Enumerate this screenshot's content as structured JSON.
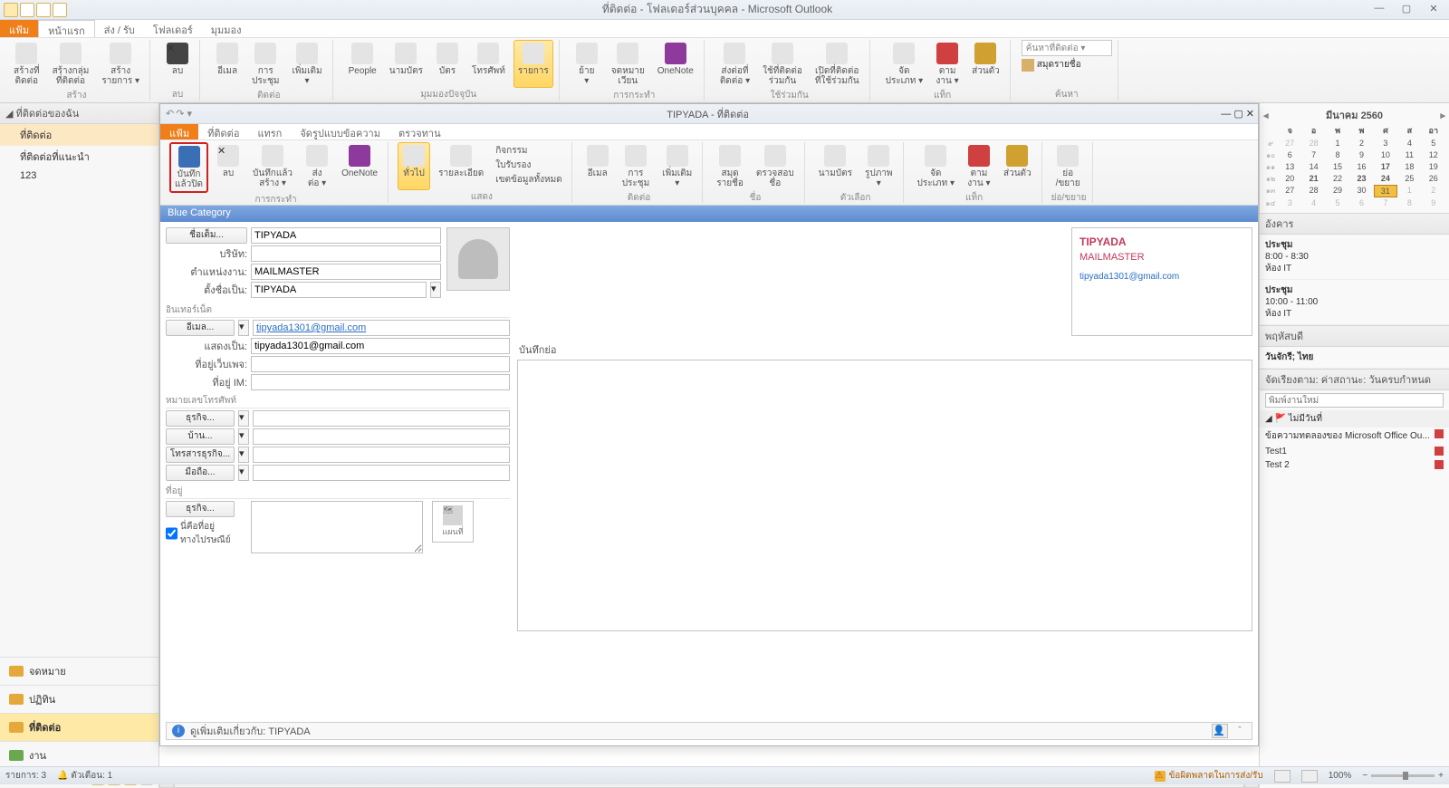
{
  "titlebar": {
    "title": "ที่ติดต่อ - โฟลเดอร์ส่วนบุคคล - Microsoft Outlook"
  },
  "tabs": {
    "file": "แฟ้ม",
    "home": "หน้าแรก",
    "send": "ส่ง / รับ",
    "folder": "โฟลเดอร์",
    "view": "มุมมอง"
  },
  "ribbon": {
    "g1": {
      "b1": "สร้างที่\nติดต่อ",
      "b2": "สร้างกลุ่ม\nที่ติดต่อ",
      "b3": "สร้าง\nรายการ ▾",
      "label": "สร้าง"
    },
    "g2": {
      "b1": "ลบ",
      "label": "ลบ"
    },
    "g3": {
      "b1": "อีเมล",
      "b2": "การ\nประชุม",
      "b3": "เพิ่มเติม\n▾",
      "label": "ติดต่อ"
    },
    "g4": {
      "b1": "People",
      "b2": "นามบัตร",
      "b3": "บัตร",
      "b4": "โทรศัพท์",
      "b5": "รายการ",
      "label": "มุมมองปัจจุบัน"
    },
    "g5": {
      "b1": "ย้าย\n▾",
      "b2": "จดหมาย\nเวียน",
      "b3": "OneNote",
      "label": "การกระทำ"
    },
    "g6": {
      "b1": "ส่งต่อที่\nติดต่อ ▾",
      "b2": "ใช้ที่ติดต่อ\nร่วมกัน",
      "b3": "เปิดที่ติดต่อ\nที่ใช้ร่วมกัน",
      "label": "ใช้ร่วมกัน"
    },
    "g7": {
      "b1": "จัด\nประเภท ▾",
      "b2": "ตาม\nงาน ▾",
      "b3": "ส่วนตัว",
      "label": "แท็ก"
    },
    "g8": {
      "search": "ค้นหาที่ติดต่อ ▾",
      "b1": "สมุดรายชื่อ",
      "label": "ค้นหา"
    }
  },
  "nav": {
    "hdr": "◢ ที่ติดต่อของฉัน",
    "f1": "ที่ติดต่อ",
    "f2": "ที่ติดต่อที่แนะนำ",
    "f3": "123",
    "mail": "จดหมาย",
    "cal": "ปฏิทิน",
    "contacts": "ที่ติดต่อ",
    "tasks": "งาน"
  },
  "contact": {
    "title": "TIPYADA - ที่ติดต่อ",
    "tabs": {
      "file": "แฟ้ม",
      "t1": "ที่ติดต่อ",
      "t2": "แทรก",
      "t3": "จัดรูปแบบข้อความ",
      "t4": "ตรวจทาน"
    },
    "ribbon": {
      "g1": {
        "b1": "บันทึก\nแล้วปิด",
        "b2": "ลบ",
        "b3": "บันทึกแล้ว\nสร้าง ▾",
        "b4": "ส่ง\nต่อ ▾",
        "b5": "OneNote",
        "label": "การกระทำ"
      },
      "g2": {
        "b1": "ทั่วไป",
        "b2": "รายละเอียด",
        "c1": "กิจกรรม",
        "c2": "ใบรับรอง",
        "c3": "เขตข้อมูลทั้งหมด",
        "label": "แสดง"
      },
      "g3": {
        "b1": "อีเมล",
        "b2": "การ\nประชุม",
        "b3": "เพิ่มเติม\n▾",
        "label": "ติดต่อ"
      },
      "g4": {
        "b1": "สมุด\nรายชื่อ",
        "b2": "ตรวจสอบ\nชื่อ",
        "label": "ชื่อ"
      },
      "g5": {
        "b1": "นามบัตร",
        "b2": "รูปภาพ\n▾",
        "label": "ตัวเลือก"
      },
      "g6": {
        "b1": "จัด\nประเภท ▾",
        "b2": "ตาม\nงาน ▾",
        "b3": "ส่วนตัว",
        "label": "แท็ก"
      },
      "g7": {
        "b1": "ย่อ\n/ขยาย",
        "label": "ย่อ/ขยาย"
      }
    },
    "category": "Blue Category",
    "fields": {
      "fullname_btn": "ชื่อเต็ม...",
      "fullname": "TIPYADA",
      "company_lbl": "บริษัท:",
      "company": "",
      "jobtitle_lbl": "ตำแหน่งงาน:",
      "jobtitle": "MAILMASTER",
      "fileas_lbl": "ตั้งชื่อเป็น:",
      "fileas": "TIPYADA",
      "internet_hdr": "อินเทอร์เน็ต",
      "email_btn": "อีเมล...",
      "email": "tipyada1301@gmail.com",
      "displayas_lbl": "แสดงเป็น:",
      "displayas": "tipyada1301@gmail.com",
      "webpage_lbl": "ที่อยู่เว็บเพจ:",
      "im_lbl": "ที่อยู่ IM:",
      "phone_hdr": "หมายเลขโทรศัพท์",
      "biz_btn": "ธุรกิจ...",
      "home_btn": "บ้าน...",
      "fax_btn": "โทรสารธุรกิจ...",
      "mobile_btn": "มือถือ...",
      "addr_hdr": "ที่อยู่",
      "addr_btn": "ธุรกิจ...",
      "mailing_chk": "นี่คือที่อยู่\nทางไปรษณีย์",
      "map_btn": "แผนที่"
    },
    "notes_lbl": "บันทึกย่อ",
    "card": {
      "name": "TIPYADA",
      "company": "MAILMASTER",
      "email": "tipyada1301@gmail.com"
    },
    "info": "ดูเพิ่มเติมเกี่ยวกับ: TIPYADA"
  },
  "calendar": {
    "month": "มีนาคม 2560",
    "dow": [
      "จ",
      "อ",
      "พ",
      "พ",
      "ศ",
      "ส",
      "อา"
    ],
    "weeks": [
      {
        "wk": "๙",
        "days": [
          {
            "n": "27",
            "o": 1
          },
          {
            "n": "28",
            "o": 1
          },
          {
            "n": "1"
          },
          {
            "n": "2"
          },
          {
            "n": "3"
          },
          {
            "n": "4"
          },
          {
            "n": "5"
          }
        ]
      },
      {
        "wk": "๑๐",
        "days": [
          {
            "n": "6"
          },
          {
            "n": "7"
          },
          {
            "n": "8"
          },
          {
            "n": "9"
          },
          {
            "n": "10"
          },
          {
            "n": "11"
          },
          {
            "n": "12"
          }
        ]
      },
      {
        "wk": "๑๑",
        "days": [
          {
            "n": "13"
          },
          {
            "n": "14"
          },
          {
            "n": "15"
          },
          {
            "n": "16"
          },
          {
            "n": "17",
            "b": 1
          },
          {
            "n": "18"
          },
          {
            "n": "19"
          }
        ]
      },
      {
        "wk": "๑๒",
        "days": [
          {
            "n": "20"
          },
          {
            "n": "21",
            "b": 1
          },
          {
            "n": "22"
          },
          {
            "n": "23",
            "b": 1
          },
          {
            "n": "24",
            "b": 1
          },
          {
            "n": "25"
          },
          {
            "n": "26"
          }
        ]
      },
      {
        "wk": "๑๓",
        "days": [
          {
            "n": "27"
          },
          {
            "n": "28"
          },
          {
            "n": "29"
          },
          {
            "n": "30"
          },
          {
            "n": "31",
            "t": 1
          },
          {
            "n": "1",
            "o": 1
          },
          {
            "n": "2",
            "o": 1
          }
        ]
      },
      {
        "wk": "๑๔",
        "days": [
          {
            "n": "3",
            "o": 1
          },
          {
            "n": "4",
            "o": 1
          },
          {
            "n": "5",
            "o": 1
          },
          {
            "n": "6",
            "o": 1
          },
          {
            "n": "7",
            "o": 1
          },
          {
            "n": "8",
            "o": 1
          },
          {
            "n": "9",
            "o": 1
          }
        ]
      }
    ]
  },
  "events": {
    "hdr": "อังคาร",
    "e1": {
      "title": "ประชุม",
      "time": "8:00 - 8:30",
      "loc": "ห้อง IT"
    },
    "e2": {
      "title": "ประชุม",
      "time": "10:00 - 11:00",
      "loc": "ห้อง IT"
    },
    "hdr2": "พฤหัสบดี",
    "e3": {
      "title": "วันจักรี; ไทย"
    }
  },
  "tasks": {
    "hdr": "จัดเรียงตาม: ค่าสถานะ: วันครบกำหนด",
    "new_ph": "พิมพ์งานใหม่",
    "section": "◢ 🚩 ไม่มีวันที่",
    "t1": "ข้อความทดลองของ Microsoft Office Ou...",
    "t2": "Test1",
    "t3": "Test 2"
  },
  "status": {
    "items": "รายการ: 3",
    "reminders": "ตัวเตือน: 1",
    "warn": "ข้อผิดพลาดในการส่ง/รับ",
    "zoom": "100%"
  }
}
